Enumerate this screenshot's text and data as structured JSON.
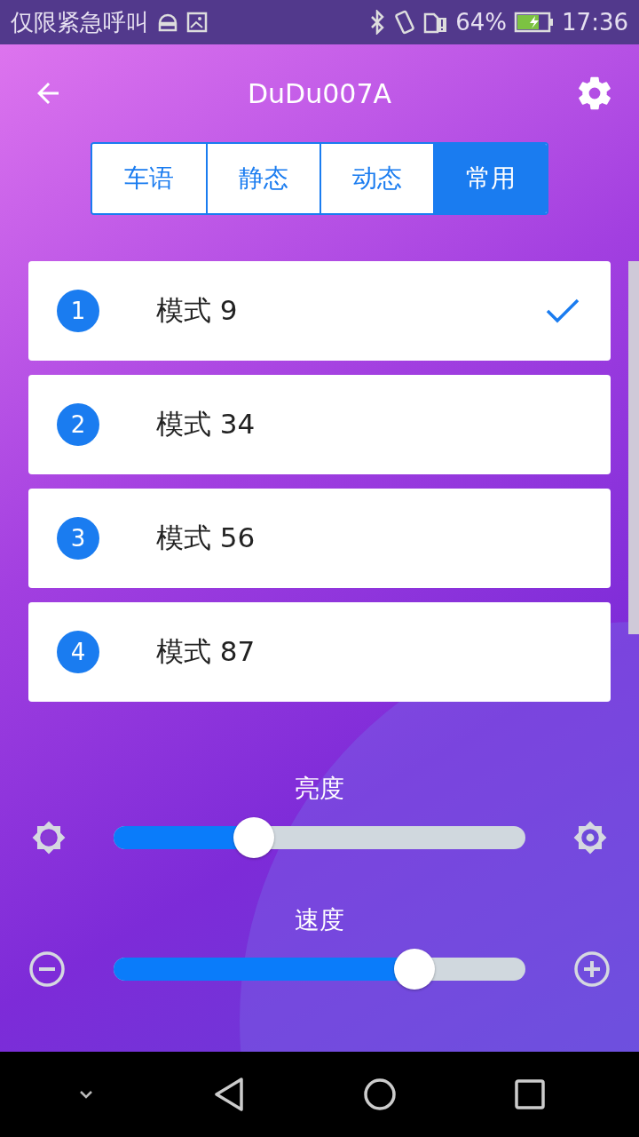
{
  "status_bar": {
    "carrier": "仅限紧急呼叫",
    "battery": "64%",
    "time": "17:36"
  },
  "app_bar": {
    "title": "DuDu007A"
  },
  "tabs": [
    {
      "label": "车语",
      "selected": false
    },
    {
      "label": "静态",
      "selected": false
    },
    {
      "label": "动态",
      "selected": false
    },
    {
      "label": "常用",
      "selected": true
    }
  ],
  "modes": [
    {
      "number": "1",
      "name": "模式 9",
      "selected": true
    },
    {
      "number": "2",
      "name": "模式 34",
      "selected": false
    },
    {
      "number": "3",
      "name": "模式 56",
      "selected": false
    },
    {
      "number": "4",
      "name": "模式 87",
      "selected": false
    }
  ],
  "sliders": [
    {
      "kind": "brightness",
      "label": "亮度",
      "level": 0.34
    },
    {
      "kind": "speed",
      "label": "速度",
      "level": 0.73
    }
  ]
}
